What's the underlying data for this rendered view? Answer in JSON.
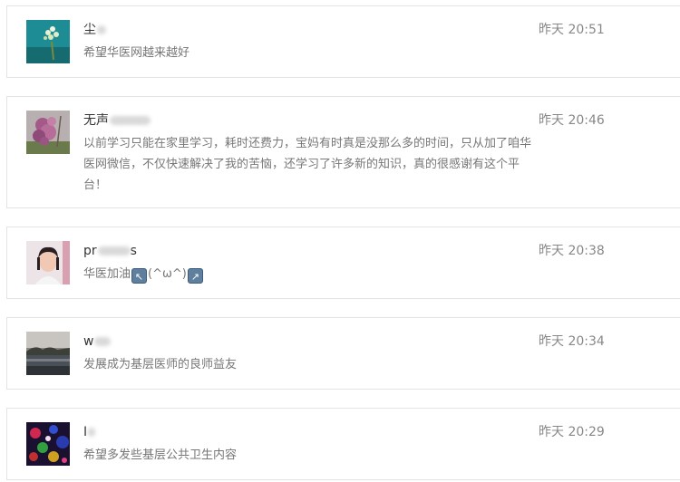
{
  "comments": [
    {
      "name_visible": "尘",
      "time": "昨天 20:51",
      "text": "希望华医网越来越好",
      "avatar": "flower-on-teal-photo"
    },
    {
      "name_visible": "无声",
      "time": "昨天 20:46",
      "text": "以前学习只能在家里学习，耗时还费力，宝妈有时真是没那么多的时间，只从加了咱华医网微信，不仅快速解决了我的苦恼，还学习了许多新的知识，真的很感谢有这个平台！",
      "avatar": "purple-blossom-photo"
    },
    {
      "name_visible": "pr",
      "name_tail": "s",
      "time": "昨天 20:38",
      "text_a": "华医加油",
      "emoji_a": "↖",
      "text_b": "(^ω^)",
      "emoji_b": "↗",
      "avatar": "woman-portrait-photo"
    },
    {
      "name_visible": "w",
      "time": "昨天 20:34",
      "text": "发展成为基层医师的良师益友",
      "avatar": "lake-sunset-photo"
    },
    {
      "name_visible": "I",
      "time": "昨天 20:29",
      "text": "希望多发些基层公共卫生内容",
      "avatar": "colorful-lights-photo"
    }
  ]
}
